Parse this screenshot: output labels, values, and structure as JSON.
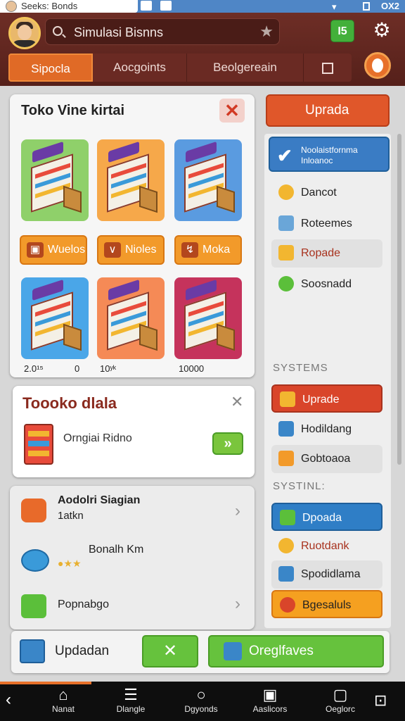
{
  "status": {
    "app_name": "Seeks: Bonds",
    "right": "OX2"
  },
  "header": {
    "search_text": "Simulasi Bisnns",
    "green_button": "I5",
    "tabs": [
      {
        "label": "Sipocla"
      },
      {
        "label": "Aocgoints"
      },
      {
        "label": "Beolgereain"
      }
    ]
  },
  "store_card": {
    "title": "Toko Vine kirtai",
    "close": "✕",
    "chips": [
      {
        "icon": "▣",
        "label": "Wuelos"
      },
      {
        "icon": "∨",
        "label": "Nioles"
      },
      {
        "icon": "↯",
        "label": "Moka"
      }
    ],
    "prices": [
      "2.0¹⁵",
      "0",
      "10ʸᵏ",
      "10000"
    ]
  },
  "detail_card": {
    "title": "Toooko dlala",
    "close": "✕",
    "subtitle": "Orngiai Ridno",
    "go": "»"
  },
  "list_card": {
    "items": [
      {
        "title": "Aodolri Siagian",
        "sub": "1atkn"
      },
      {
        "title": "Bonalh Km"
      },
      {
        "title": "Popnabgo"
      }
    ]
  },
  "footer": {
    "primary_label": "Updadan",
    "x_label": "✕",
    "secondary_label": "Oreglfaves"
  },
  "sidebar": {
    "update_button": "Uprada",
    "banner": "Noolaistfornma Inloanoc",
    "group1": [
      {
        "label": "Dancot"
      },
      {
        "label": "Roteemes"
      },
      {
        "label": "Ropade"
      },
      {
        "label": "Soosnadd"
      }
    ],
    "heading2": "SYSTEMS",
    "group2": [
      {
        "label": "Uprade"
      },
      {
        "label": "Hodildang"
      },
      {
        "label": "Gobtoaoa"
      }
    ],
    "heading3": "SYSTINL:",
    "group3": [
      {
        "label": "Dpoada"
      },
      {
        "label": "Ruotdank"
      },
      {
        "label": "Spodidlama"
      },
      {
        "label": "Bgesaluls"
      }
    ]
  },
  "navbar": {
    "items": [
      {
        "label": "Nanat"
      },
      {
        "label": "Dlangle"
      },
      {
        "label": "Dgyonds"
      },
      {
        "label": "Aaslicors"
      },
      {
        "label": "Oeglorc"
      }
    ]
  },
  "colors": {
    "accent": "#e06a26",
    "brand": "#6e2e26",
    "success": "#66c23d",
    "info": "#3a86c8"
  }
}
